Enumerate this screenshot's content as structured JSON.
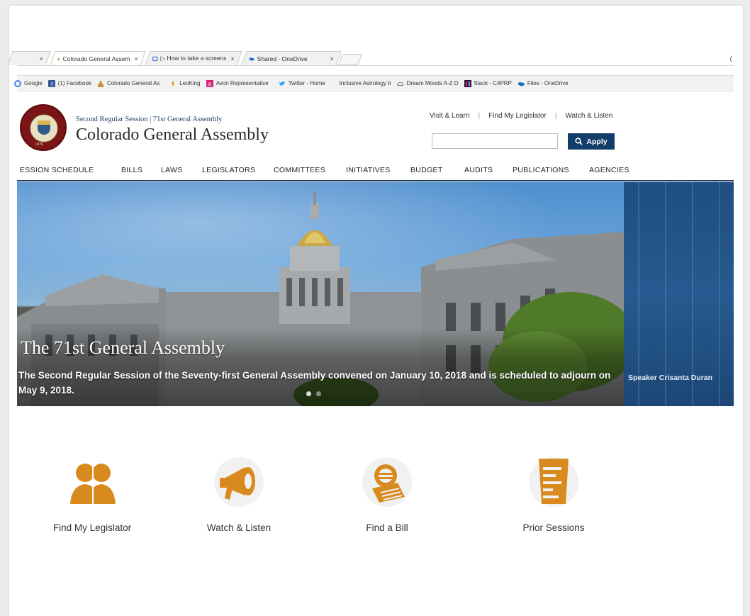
{
  "browser": {
    "tabs": [
      {
        "label": "",
        "close": "×"
      },
      {
        "label": "Colorado General Assem",
        "close": "×"
      },
      {
        "label": "▷ How to take a screens",
        "close": "×"
      },
      {
        "label": "Shared - OneDrive",
        "close": "×"
      }
    ],
    "bookmarks": [
      {
        "label": "Google",
        "icon": "google-icon"
      },
      {
        "label": "(1) Facebook",
        "icon": "facebook-icon"
      },
      {
        "label": "Colorado General As",
        "icon": "capitol-icon"
      },
      {
        "label": "LeoKing",
        "icon": "leo-icon"
      },
      {
        "label": "Avon Representative",
        "icon": "avon-icon"
      },
      {
        "label": "Twitter - Home",
        "icon": "twitter-icon"
      },
      {
        "label": "Inclusive Astrology b",
        "icon": ""
      },
      {
        "label": "Dream Moods A-Z D",
        "icon": "cloud-icon"
      },
      {
        "label": "Slack - C4PRP",
        "icon": "slack-icon"
      },
      {
        "label": "Files - OneDrive",
        "icon": "onedrive-icon"
      }
    ],
    "edge_mark": "("
  },
  "site": {
    "session_line": "Second Regular Session | 71st General Assembly",
    "title": "Colorado General Assembly",
    "seal_year": "1876",
    "top_links": [
      "Visit & Learn",
      "Find My Legislator",
      "Watch & Listen"
    ],
    "search": {
      "value": "",
      "placeholder": ""
    },
    "apply_label": "Apply",
    "nav": [
      "ESSION SCHEDULE",
      "BILLS",
      "LAWS",
      "LEGISLATORS",
      "COMMITTEES",
      "INITIATIVES",
      "BUDGET",
      "AUDITS",
      "PUBLICATIONS",
      "AGENCIES"
    ],
    "accent_color": "#143e6a",
    "icon_color": "#d88a1f"
  },
  "hero": {
    "title": "The 71st General Assembly",
    "subtitle": "The Second Regular Session of the Seventy-first General Assembly convened on January 10, 2018 and is scheduled to adjourn on May 9, 2018.",
    "side_caption": "Speaker Crisanta Duran"
  },
  "quick_links": [
    {
      "label": "Find My Legislator",
      "icon": "people-icon"
    },
    {
      "label": "Watch & Listen",
      "icon": "megaphone-icon"
    },
    {
      "label": "Find a Bill",
      "icon": "documents-icon"
    },
    {
      "label": "Prior Sessions",
      "icon": "archive-icon"
    }
  ]
}
